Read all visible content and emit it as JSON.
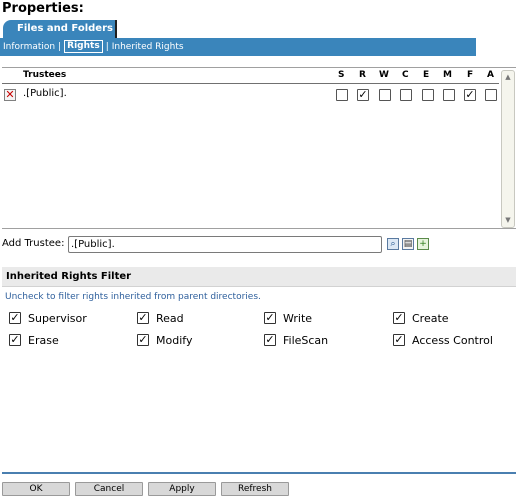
{
  "title": "Properties:",
  "tab": {
    "label": "Files and Folders"
  },
  "subnav": {
    "items": [
      "Information",
      "Rights",
      "Inherited Rights"
    ],
    "active": "Rights",
    "separator": "|"
  },
  "trustees": {
    "columns": [
      "Trustees",
      "S",
      "R",
      "W",
      "C",
      "E",
      "M",
      "F",
      "A"
    ],
    "rows": [
      {
        "name": ".[Public].",
        "rights": {
          "S": false,
          "R": true,
          "W": false,
          "C": false,
          "E": false,
          "M": false,
          "F": true,
          "A": false
        }
      }
    ]
  },
  "add_trustee": {
    "label": "Add Trustee:",
    "value": ".[Public]."
  },
  "irf": {
    "title": "Inherited Rights Filter",
    "hint": "Uncheck to filter rights inherited from parent directories.",
    "items": [
      {
        "label": "Supervisor",
        "checked": true
      },
      {
        "label": "Read",
        "checked": true
      },
      {
        "label": "Write",
        "checked": true
      },
      {
        "label": "Create",
        "checked": true
      },
      {
        "label": "Erase",
        "checked": true
      },
      {
        "label": "Modify",
        "checked": true
      },
      {
        "label": "FileScan",
        "checked": true
      },
      {
        "label": "Access Control",
        "checked": true
      }
    ]
  },
  "buttons": {
    "ok": "OK",
    "cancel": "Cancel",
    "apply": "Apply",
    "refresh": "Refresh"
  },
  "colors": {
    "accent": "#3a85bb",
    "delete": "#c80000",
    "hint": "#2e5f9c"
  },
  "icons": {
    "delete": "delete-x-icon",
    "search": "search-icon",
    "browse": "browse-tree-icon",
    "add": "add-plus-icon"
  }
}
